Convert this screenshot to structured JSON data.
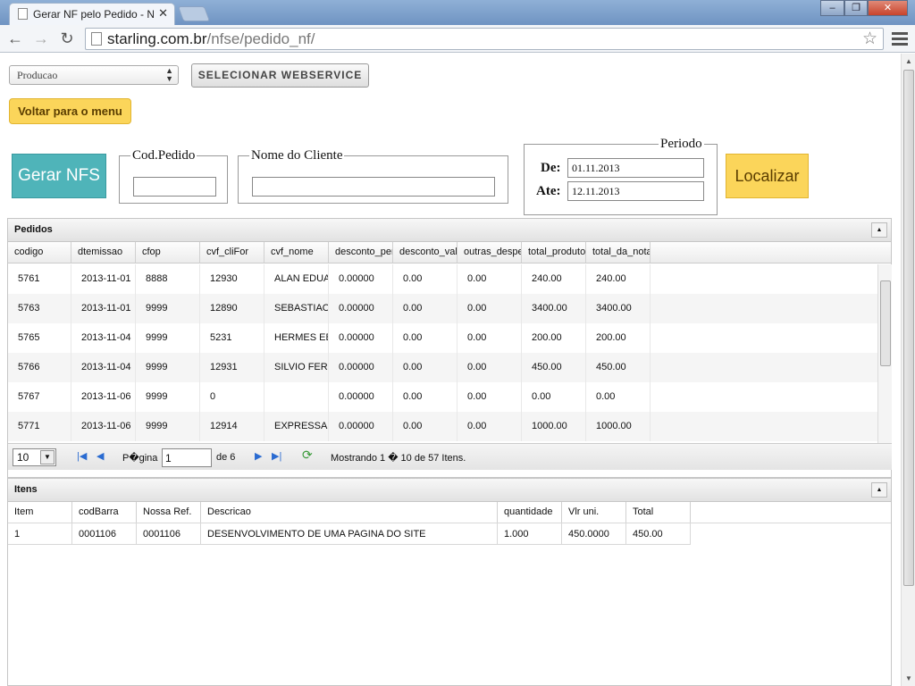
{
  "browser": {
    "tab_title": "Gerar NF pelo Pedido - Nc",
    "url_host": "starling.com.br",
    "url_path": "/nfse/pedido_nf/"
  },
  "form": {
    "environment_select": "Producao",
    "select_webservice_label": "SELECIONAR WEBSERVICE",
    "back_to_menu_label": "Voltar para o menu",
    "gerar_nfs_label": "Gerar NFS",
    "cod_pedido_legend": "Cod.Pedido",
    "cod_pedido_value": "",
    "nome_cliente_legend": "Nome do Cliente",
    "nome_cliente_value": "",
    "periodo_legend": "Periodo",
    "de_label": "De:",
    "de_value": "01.11.2013",
    "ate_label": "Ate:",
    "ate_value": "12.11.2013",
    "localizar_label": "Localizar"
  },
  "pedidos": {
    "title": "Pedidos",
    "columns": [
      "codigo",
      "dtemissao",
      "cfop",
      "cvf_cliFor",
      "cvf_nome",
      "desconto_per",
      "desconto_val",
      "outras_despe",
      "total_produtos",
      "total_da_nota"
    ],
    "rows": [
      [
        "5761",
        "2013-11-01",
        "8888",
        "12930",
        "ALAN EDUA",
        "0.00000",
        "0.00",
        "0.00",
        "240.00",
        "240.00"
      ],
      [
        "5763",
        "2013-11-01",
        "9999",
        "12890",
        "SEBASTIAO",
        "0.00000",
        "0.00",
        "0.00",
        "3400.00",
        "3400.00"
      ],
      [
        "5765",
        "2013-11-04",
        "9999",
        "5231",
        "HERMES EB",
        "0.00000",
        "0.00",
        "0.00",
        "200.00",
        "200.00"
      ],
      [
        "5766",
        "2013-11-04",
        "9999",
        "12931",
        "SILVIO FER",
        "0.00000",
        "0.00",
        "0.00",
        "450.00",
        "450.00"
      ],
      [
        "5767",
        "2013-11-06",
        "9999",
        "0",
        "",
        "0.00000",
        "0.00",
        "0.00",
        "0.00",
        "0.00"
      ],
      [
        "5771",
        "2013-11-06",
        "9999",
        "12914",
        "EXPRESSA (",
        "0.00000",
        "0.00",
        "0.00",
        "1000.00",
        "1000.00"
      ]
    ],
    "pager": {
      "page_size": "10",
      "page_label": "P�gina",
      "page_value": "1",
      "of_label": "de 6",
      "summary": "Mostrando 1 � 10 de 57 Itens."
    }
  },
  "itens": {
    "title": "Itens",
    "columns": [
      "Item",
      "codBarra",
      "Nossa Ref.",
      "Descricao",
      "quantidade",
      "Vlr uni.",
      "Total"
    ],
    "rows": [
      [
        "1",
        "0001106",
        "0001106",
        "DESENVOLVIMENTO DE UMA PAGINA DO SITE",
        "1.000",
        "450.0000",
        "450.00"
      ]
    ]
  }
}
